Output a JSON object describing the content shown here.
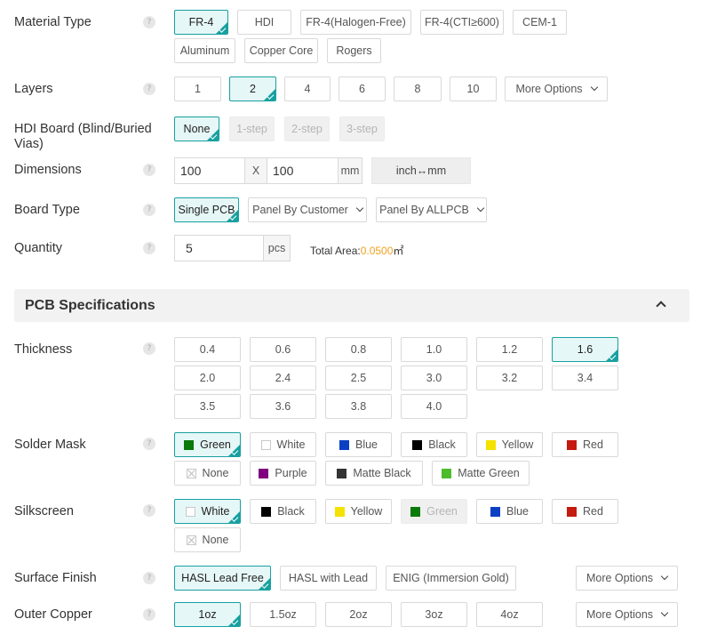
{
  "help_glyph": "?",
  "material": {
    "label": "Material Type",
    "options": [
      "FR-4",
      "HDI",
      "FR-4(Halogen-Free)",
      "FR-4(CTI≥600)",
      "CEM-1",
      "Aluminum",
      "Copper Core",
      "Rogers"
    ],
    "selected": "FR-4"
  },
  "layers": {
    "label": "Layers",
    "options": [
      "1",
      "2",
      "4",
      "6",
      "8",
      "10"
    ],
    "selected": "2",
    "more": "More Options"
  },
  "hdi": {
    "label": "HDI Board (Blind/Buried Vias)",
    "options": [
      "None",
      "1-step",
      "2-step",
      "3-step"
    ],
    "selected": "None"
  },
  "dimensions": {
    "label": "Dimensions",
    "width": "100",
    "sep": "X",
    "height": "100",
    "unit": "mm",
    "toggle": "inch↔mm"
  },
  "board_type": {
    "label": "Board Type",
    "options": [
      "Single PCB",
      "Panel By Customer",
      "Panel By ALLPCB"
    ],
    "selected": "Single PCB"
  },
  "quantity": {
    "label": "Quantity",
    "value": "5",
    "unit": "pcs",
    "total_label": "Total Area:",
    "total_value": "0.0500",
    "total_unit": "㎡"
  },
  "section": {
    "title": "PCB Specifications"
  },
  "thickness": {
    "label": "Thickness",
    "options": [
      "0.4",
      "0.6",
      "0.8",
      "1.0",
      "1.2",
      "1.6",
      "2.0",
      "2.4",
      "2.5",
      "3.0",
      "3.2",
      "3.4",
      "3.5",
      "3.6",
      "3.8",
      "4.0"
    ],
    "selected": "1.6"
  },
  "solder_mask": {
    "label": "Solder Mask",
    "options": [
      {
        "name": "Green",
        "color": "#0a7a0a"
      },
      {
        "name": "White",
        "color": "#ffffff"
      },
      {
        "name": "Blue",
        "color": "#0b3fc4"
      },
      {
        "name": "Black",
        "color": "#000000"
      },
      {
        "name": "Yellow",
        "color": "#f5e200"
      },
      {
        "name": "Red",
        "color": "#c41a10"
      },
      {
        "name": "None",
        "color": "none"
      },
      {
        "name": "Purple",
        "color": "#800080"
      },
      {
        "name": "Matte Black",
        "color": "#333333"
      },
      {
        "name": "Matte Green",
        "color": "#4cbc2a"
      }
    ],
    "selected": "Green"
  },
  "silkscreen": {
    "label": "Silkscreen",
    "options": [
      {
        "name": "White",
        "color": "#ffffff"
      },
      {
        "name": "Black",
        "color": "#000000"
      },
      {
        "name": "Yellow",
        "color": "#f5e200"
      },
      {
        "name": "Green",
        "color": "#0a7a0a"
      },
      {
        "name": "Blue",
        "color": "#0b3fc4"
      },
      {
        "name": "Red",
        "color": "#c41a10"
      },
      {
        "name": "None",
        "color": "none"
      }
    ],
    "selected": "White",
    "disabled": [
      "Green"
    ]
  },
  "surface_finish": {
    "label": "Surface Finish",
    "options": [
      "HASL Lead Free",
      "HASL with Lead",
      "ENIG (Immersion Gold)"
    ],
    "selected": "HASL Lead Free",
    "more": "More Options"
  },
  "outer_copper": {
    "label": "Outer Copper",
    "options": [
      "1oz",
      "1.5oz",
      "2oz",
      "3oz",
      "4oz"
    ],
    "selected": "1oz",
    "more": "More Options"
  },
  "accent_color": "#18a0a0",
  "highlight_color": "#f0a020"
}
